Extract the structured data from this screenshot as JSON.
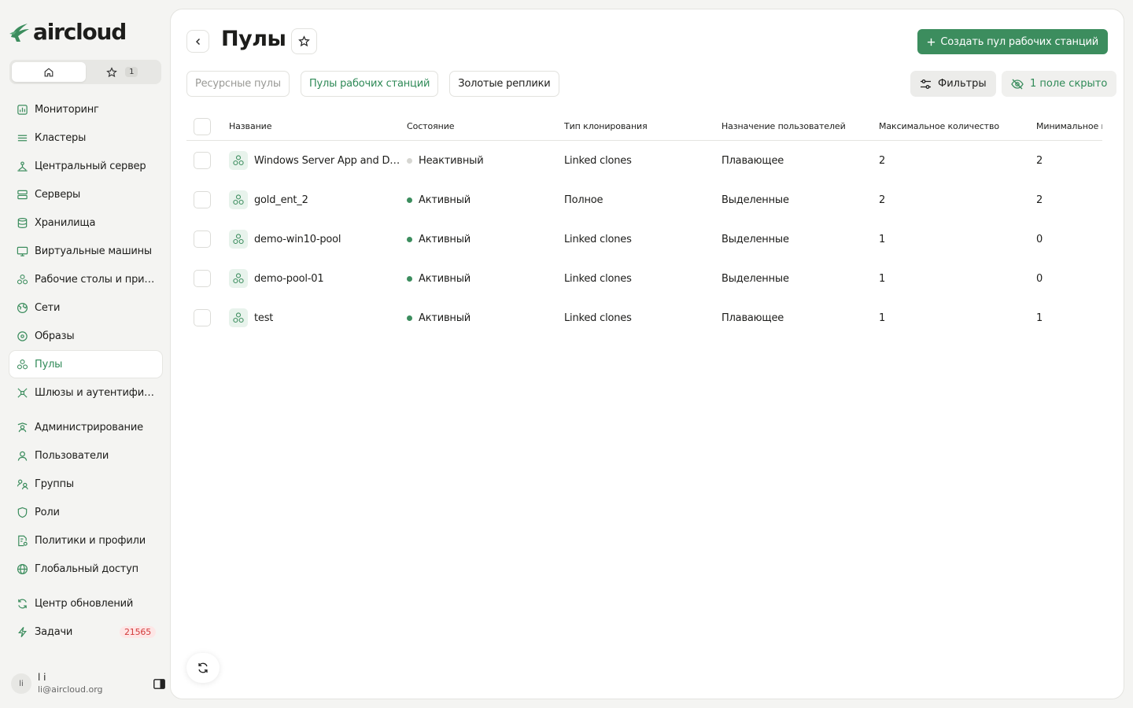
{
  "brand": {
    "name": "aircloud",
    "accent": "#3c8d5e"
  },
  "home_switch": {
    "home_icon": "home-icon",
    "favorites_icon": "star-icon",
    "favorites_count": "1"
  },
  "sidebar": {
    "items": [
      {
        "key": "monitoring",
        "label": "Мониторинг",
        "icon": "chart-icon"
      },
      {
        "key": "clusters",
        "label": "Кластеры",
        "icon": "layers-icon"
      },
      {
        "key": "central-server",
        "label": "Центральный сервер",
        "icon": "network-icon"
      },
      {
        "key": "servers",
        "label": "Серверы",
        "icon": "server-icon"
      },
      {
        "key": "storage",
        "label": "Хранилища",
        "icon": "database-icon"
      },
      {
        "key": "vms",
        "label": "Виртуальные машины",
        "icon": "monitor-icon"
      },
      {
        "key": "desktops",
        "label": "Рабочие столы и приложения",
        "icon": "pool-icon"
      },
      {
        "key": "networks",
        "label": "Сети",
        "icon": "globe-network-icon"
      },
      {
        "key": "images",
        "label": "Образы",
        "icon": "disc-icon"
      },
      {
        "key": "pools",
        "label": "Пулы",
        "icon": "pool-icon",
        "active": true
      },
      {
        "key": "gateways",
        "label": "Шлюзы и аутентификация",
        "icon": "gateway-icon"
      },
      {
        "key": "admin",
        "label": "Администрирование",
        "icon": "admin-icon"
      },
      {
        "key": "users",
        "label": "Пользователи",
        "icon": "user-icon"
      },
      {
        "key": "groups",
        "label": "Группы",
        "icon": "group-icon"
      },
      {
        "key": "roles",
        "label": "Роли",
        "icon": "shield-icon"
      },
      {
        "key": "policies",
        "label": "Политики и профили",
        "icon": "policy-icon"
      },
      {
        "key": "global-access",
        "label": "Глобальный доступ",
        "icon": "globe-icon"
      },
      {
        "key": "updates",
        "label": "Центр обновлений",
        "icon": "refresh-icon"
      },
      {
        "key": "tasks",
        "label": "Задачи",
        "icon": "lightning-icon",
        "badge": "21565"
      }
    ]
  },
  "user": {
    "initials": "li",
    "name": "l i",
    "email": "li@aircloud.org"
  },
  "header": {
    "title": "Пулы",
    "create_label": "Создать пул рабочих станций",
    "tabs": [
      {
        "label": "Ресурсные пулы",
        "state": "muted"
      },
      {
        "label": "Пулы рабочих станций",
        "state": "active"
      },
      {
        "label": "Золотые реплики",
        "state": "normal"
      }
    ],
    "filters_label": "Фильтры",
    "hidden_fields_label": "1 поле скрыто"
  },
  "table": {
    "columns": [
      "Название",
      "Состояние",
      "Тип клонирования",
      "Назначение пользователей",
      "Максимальное количество",
      "Минимальное к"
    ],
    "rows": [
      {
        "name": "Windows Server App and Desktop",
        "state": "Неактивный",
        "active": false,
        "clone": "Linked clones",
        "assign": "Плавающее",
        "max": "2",
        "min": "2"
      },
      {
        "name": "gold_ent_2",
        "state": "Активный",
        "active": true,
        "clone": "Полное",
        "assign": "Выделенные",
        "max": "2",
        "min": "2"
      },
      {
        "name": "demo-win10-pool",
        "state": "Активный",
        "active": true,
        "clone": "Linked clones",
        "assign": "Выделенные",
        "max": "1",
        "min": "0"
      },
      {
        "name": "demo-pool-01",
        "state": "Активный",
        "active": true,
        "clone": "Linked clones",
        "assign": "Выделенные",
        "max": "1",
        "min": "0"
      },
      {
        "name": "test",
        "state": "Активный",
        "active": true,
        "clone": "Linked clones",
        "assign": "Плавающее",
        "max": "1",
        "min": "1"
      }
    ],
    "status_colors": {
      "active": "#3c8d5e",
      "inactive": "#d6d6d2"
    }
  }
}
